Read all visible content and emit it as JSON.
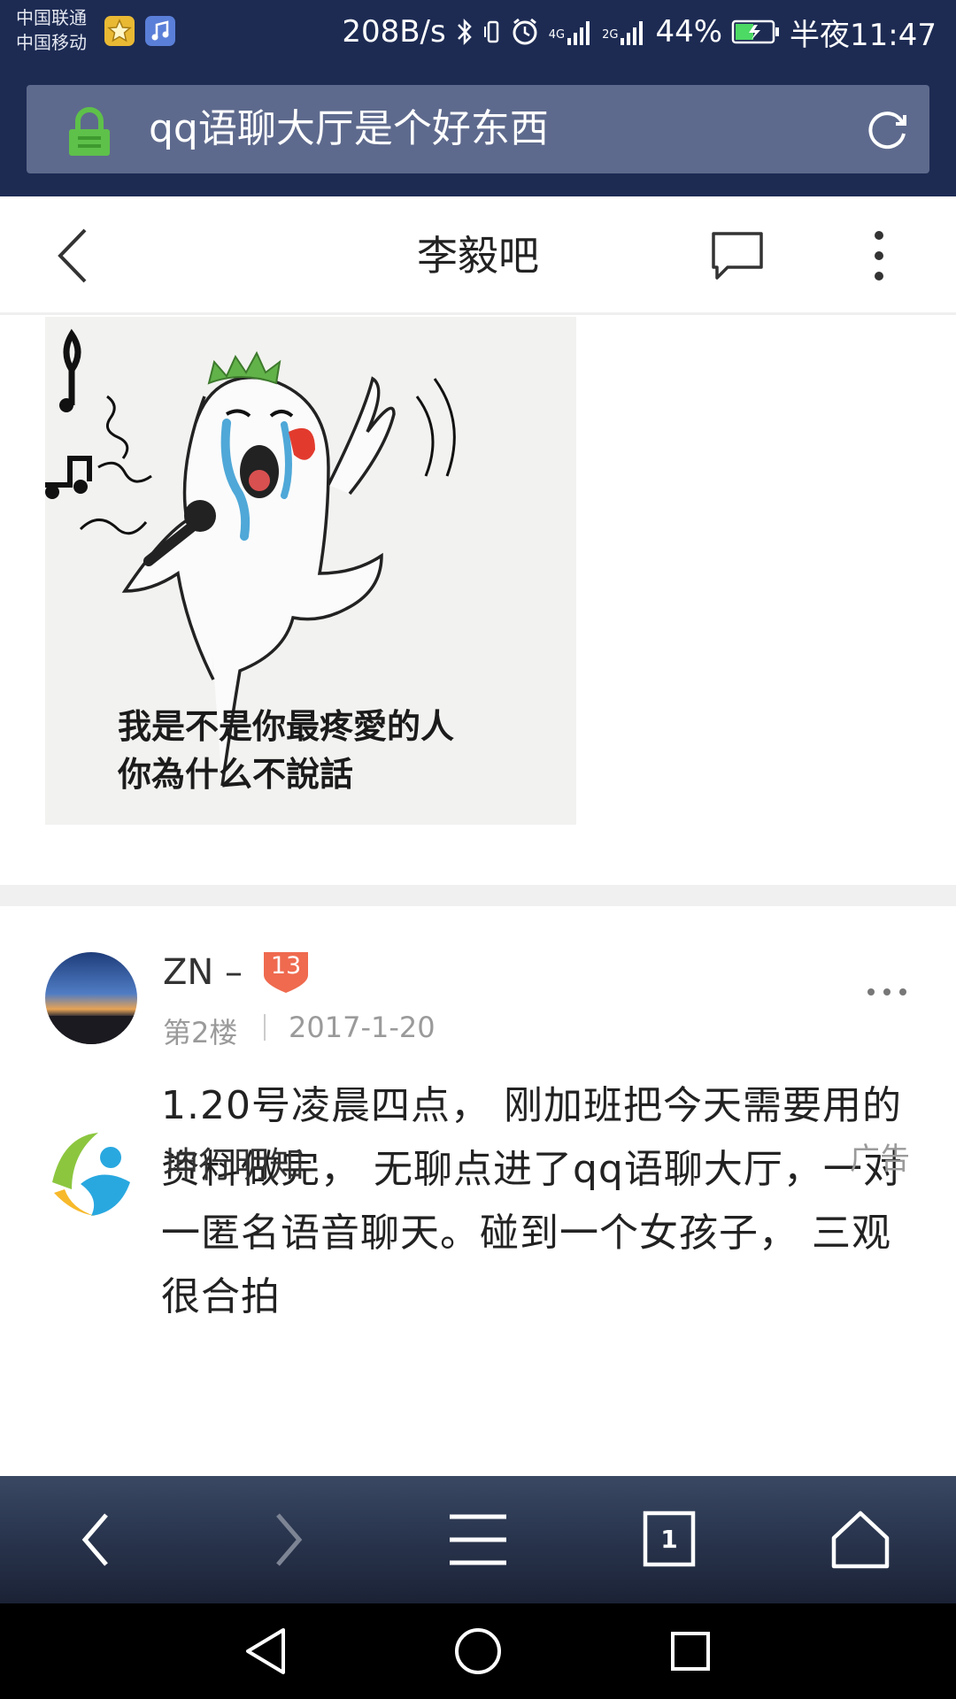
{
  "status_bar": {
    "carrier_1": "中国联通",
    "carrier_2": "中国移动",
    "net_speed": "208B/s",
    "network_4g": "4G",
    "network_2g": "2G",
    "battery": "44%",
    "time": "半夜11:47"
  },
  "url_bar": {
    "query": "qq语聊大厅是个好东西"
  },
  "page_header": {
    "title": "李毅吧"
  },
  "meme": {
    "caption_line1": "我是不是你最疼愛的人",
    "caption_line2": "你為什么不說話"
  },
  "post": {
    "username": "ZN –",
    "level": "13",
    "floor": "第2楼",
    "date": "2017-1-20",
    "body": "1.20号凌晨四点， 刚加班把今天需要用的资料做完， 无聊点进了qq语聊大厅，一对一匿名语音聊天。碰到一个女孩子， 三观很合拍"
  },
  "ad": {
    "name": "坤行明知",
    "label": "广告"
  },
  "toolbar": {
    "tab_count": "1"
  },
  "colors": {
    "status_bg": "#1d2b53",
    "url_bar_bg": "#5e6a8d",
    "lock_green": "#5ec14a",
    "level_badge": "#ef6a4f"
  },
  "icons": [
    "lock-icon",
    "reload-icon",
    "back-icon",
    "comment-icon",
    "more-icon",
    "level-badge-icon",
    "toolbar-back-icon",
    "toolbar-forward-icon",
    "menu-icon",
    "tabs-icon",
    "home-icon",
    "nav-back-icon",
    "nav-home-icon",
    "nav-recents-icon"
  ]
}
